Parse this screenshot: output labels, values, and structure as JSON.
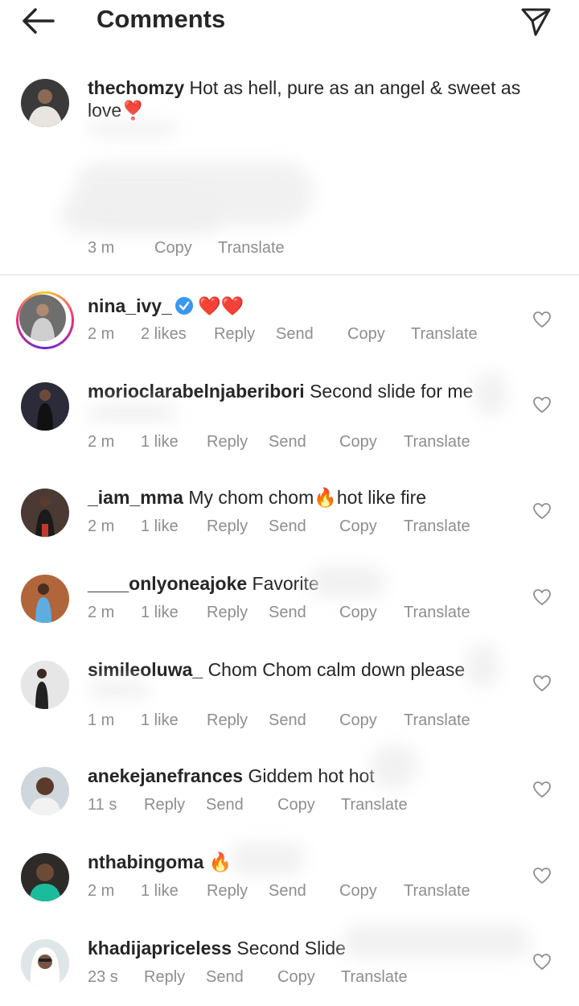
{
  "header": {
    "title": "Comments",
    "back_icon": "arrow-left-icon",
    "share_icon": "paper-plane-icon"
  },
  "caption": {
    "username": "thechomzy",
    "text": "Hot as hell, pure as an angel & sweet as love",
    "emoji": "❣️",
    "time": "3 m",
    "copy": "Copy",
    "translate": "Translate"
  },
  "labels": {
    "reply": "Reply",
    "send": "Send",
    "copy": "Copy",
    "translate": "Translate"
  },
  "comments": [
    {
      "username": "nina_ivy_",
      "verified": true,
      "text": "❤️❤️",
      "time": "2 m",
      "likes": "2 likes",
      "story_ring": true
    },
    {
      "username": "morioclarabelnjaberibori",
      "text": "Second slide for me",
      "time": "2 m",
      "likes": "1 like"
    },
    {
      "username": "_iam_mma",
      "text": "My chom chom🔥hot like fire",
      "time": "2 m",
      "likes": "1 like"
    },
    {
      "username": "____onlyoneajoke",
      "text": "Favorite",
      "time": "2 m",
      "likes": "1 like"
    },
    {
      "username": "simileoluwa_",
      "text": "Chom Chom calm down please",
      "time": "1 m",
      "likes": "1 like"
    },
    {
      "username": "anekejanefrances",
      "text": "Giddem hot hot",
      "time": "11 s",
      "likes": ""
    },
    {
      "username": "nthabingoma",
      "text": "🔥",
      "time": "2 m",
      "likes": "1 like"
    },
    {
      "username": "khadijapriceless",
      "text": "Second Slide",
      "time": "23 s",
      "likes": ""
    }
  ],
  "colors": {
    "text": "#262626",
    "secondary": "#8e8e8e",
    "verified": "#3897f0",
    "heart": "#e0245e",
    "divider": "#dbdbdb"
  }
}
